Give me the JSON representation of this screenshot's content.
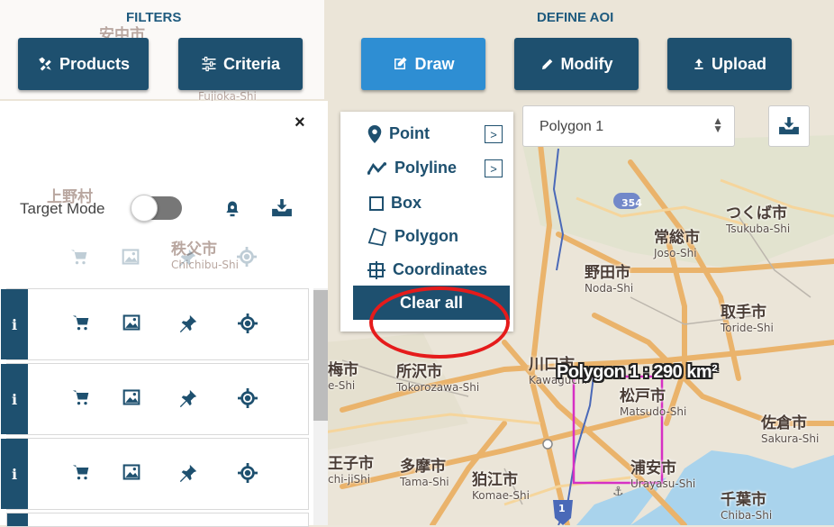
{
  "filters": {
    "title": "FILTERS",
    "products_label": "Products",
    "criteria_label": "Criteria"
  },
  "aoi": {
    "title": "DEFINE AOI",
    "draw_label": "Draw",
    "modify_label": "Modify",
    "upload_label": "Upload",
    "selected_polygon": "Polygon 1"
  },
  "draw_menu": {
    "items": [
      "Point",
      "Polyline",
      "Box",
      "Polygon",
      "Coordinates"
    ],
    "clear_all_label": "Clear all"
  },
  "panel": {
    "close_glyph": "×",
    "target_mode_label": "Target Mode",
    "target_mode_on": false,
    "info_glyph": "i"
  },
  "map": {
    "polygon_label": "Polygon 1 : 290 km²",
    "labels": [
      {
        "jp": "つくば市",
        "en": "Tsukuba-Shi"
      },
      {
        "jp": "常総市",
        "en": "Joso-Shi"
      },
      {
        "jp": "野田市",
        "en": "Noda-Shi"
      },
      {
        "jp": "取手市",
        "en": "Toride-Shi"
      },
      {
        "jp": "川口市",
        "en": "Kawaguchi"
      },
      {
        "jp": "所沢市",
        "en": "Tokorozawa-Shi"
      },
      {
        "jp": "松戸市",
        "en": "Matsudo-Shi"
      },
      {
        "jp": "佐倉市",
        "en": "Sakura-Shi"
      },
      {
        "jp": "浦安市",
        "en": "Urayasu-Shi"
      },
      {
        "jp": "千葉市",
        "en": "Chiba-Shi"
      },
      {
        "jp": "多摩市",
        "en": "Tama-Shi"
      },
      {
        "jp": "狛江市",
        "en": "Komae-Shi"
      },
      {
        "jp": "王子市",
        "en": "chi-jiShi"
      },
      {
        "jp": "梅市",
        "en": "e-Shi"
      },
      {
        "jp": "安中市",
        "en": ""
      },
      {
        "jp": "上野村",
        "en": ""
      },
      {
        "jp": "秩父市",
        "en": "Chichibu-Shi"
      }
    ],
    "road_shields": [
      "354",
      "1"
    ]
  },
  "colors": {
    "primary": "#1e506f",
    "active": "#2e8ed3",
    "polygon": "#d630c4",
    "highlight": "#e51b1b"
  }
}
